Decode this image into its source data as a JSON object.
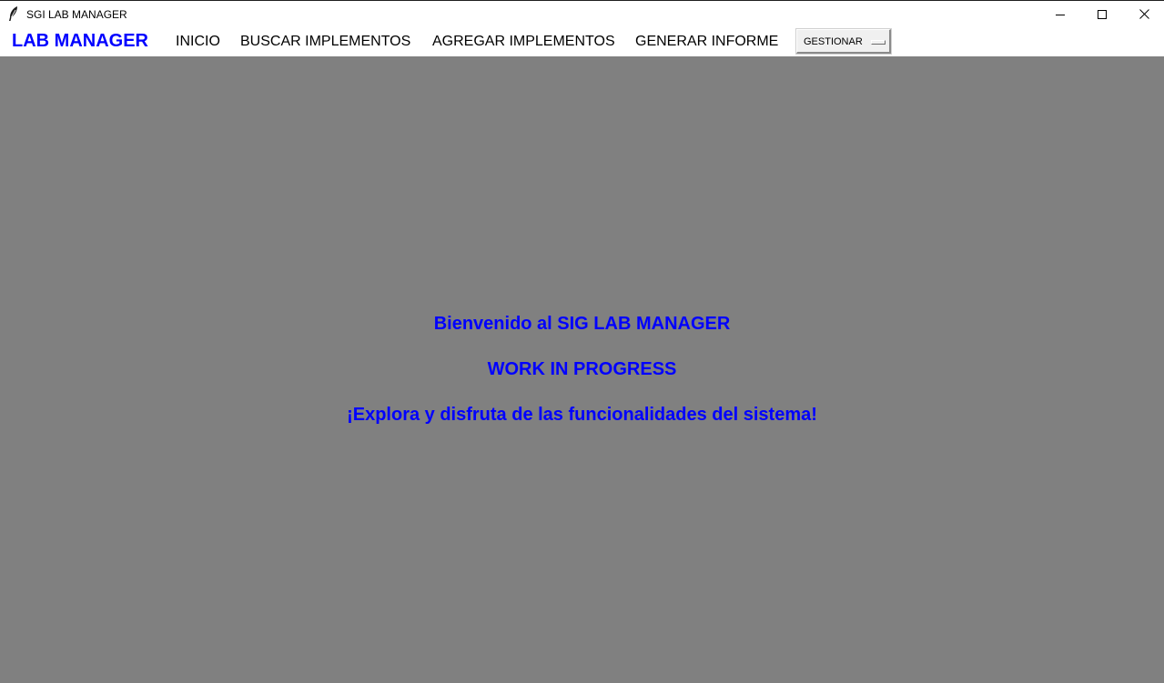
{
  "window": {
    "title": "SGI LAB MANAGER",
    "icon": "feather-icon"
  },
  "window_controls": {
    "minimize_icon": "minimize-icon",
    "maximize_icon": "maximize-icon",
    "close_icon": "close-icon"
  },
  "menubar": {
    "brand": "LAB MANAGER",
    "items": [
      {
        "label": "INICIO"
      },
      {
        "label": "BUSCAR IMPLEMENTOS"
      },
      {
        "label": "AGREGAR IMPLEMENTOS"
      },
      {
        "label": "GENERAR INFORME"
      }
    ],
    "gestionar": {
      "label": "GESTIONAR"
    }
  },
  "main": {
    "welcome": "Bienvenido al SIG LAB MANAGER",
    "status": "WORK IN PROGRESS",
    "explore": "¡Explora y disfruta de las funcionalidades del sistema!"
  },
  "colors": {
    "brand": "#0000ff",
    "content_background": "#808080",
    "message_text": "#0000ff"
  }
}
